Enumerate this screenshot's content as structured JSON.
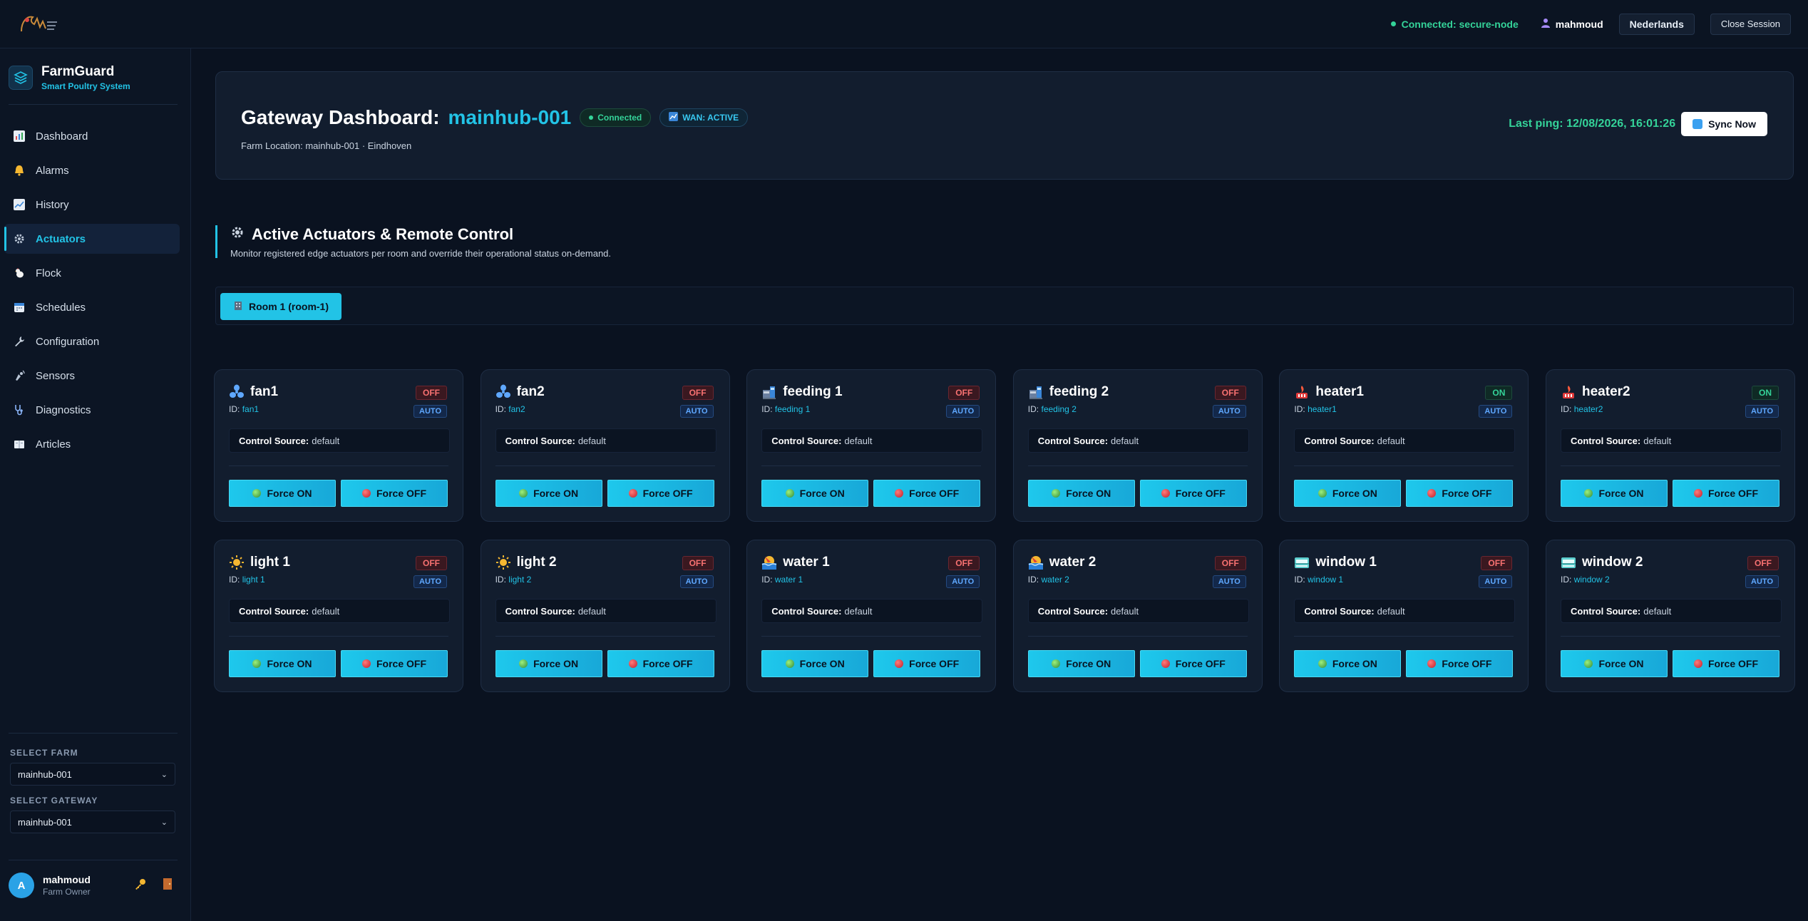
{
  "topbar": {
    "connection": "Connected: secure-node",
    "user": "mahmoud",
    "language": "Nederlands",
    "close_session": "Close Session"
  },
  "sidebar": {
    "brand_name": "FarmGuard",
    "brand_sub": "Smart Poultry System",
    "items": [
      {
        "label": "Dashboard",
        "icon": "chart-icon"
      },
      {
        "label": "Alarms",
        "icon": "bell-icon"
      },
      {
        "label": "History",
        "icon": "trend-icon"
      },
      {
        "label": "Actuators",
        "icon": "gear-icon",
        "active": true
      },
      {
        "label": "Flock",
        "icon": "chicken-icon"
      },
      {
        "label": "Schedules",
        "icon": "calendar-icon"
      },
      {
        "label": "Configuration",
        "icon": "wrench-icon"
      },
      {
        "label": "Sensors",
        "icon": "sensor-icon"
      },
      {
        "label": "Diagnostics",
        "icon": "stethoscope-icon"
      },
      {
        "label": "Articles",
        "icon": "book-icon"
      }
    ],
    "select_farm_label": "SELECT FARM",
    "select_farm_value": "mainhub-001",
    "select_gateway_label": "SELECT GATEWAY",
    "select_gateway_value": "mainhub-001",
    "user_initial": "A",
    "user_name": "mahmoud",
    "user_role": "Farm Owner"
  },
  "gateway": {
    "title": "Gateway Dashboard:",
    "hub": "mainhub-001",
    "connected": "Connected",
    "wan": "WAN: ACTIVE",
    "location": "Farm Location: mainhub-001 · Eindhoven",
    "last_ping": "Last ping: 12/08/2026, 16:01:26",
    "sync": "Sync Now"
  },
  "section": {
    "title": "Active Actuators & Remote Control",
    "desc": "Monitor registered edge actuators per room and override their operational status on-demand."
  },
  "room_tab": "Room 1 (room-1)",
  "labels": {
    "id_prefix": "ID:",
    "control_source": "Control Source:",
    "force_on": "Force ON",
    "force_off": "Force OFF"
  },
  "actuators": [
    {
      "name": "fan1",
      "id": "fan1",
      "state": "OFF",
      "mode": "AUTO",
      "source": "default",
      "icon": "fan-icon"
    },
    {
      "name": "fan2",
      "id": "fan2",
      "state": "OFF",
      "mode": "AUTO",
      "source": "default",
      "icon": "fan-icon"
    },
    {
      "name": "feeding 1",
      "id": "feeding 1",
      "state": "OFF",
      "mode": "AUTO",
      "source": "default",
      "icon": "feeder-icon"
    },
    {
      "name": "feeding 2",
      "id": "feeding 2",
      "state": "OFF",
      "mode": "AUTO",
      "source": "default",
      "icon": "feeder-icon"
    },
    {
      "name": "heater1",
      "id": "heater1",
      "state": "ON",
      "mode": "AUTO",
      "source": "default",
      "icon": "heater-icon"
    },
    {
      "name": "heater2",
      "id": "heater2",
      "state": "ON",
      "mode": "AUTO",
      "source": "default",
      "icon": "heater-icon"
    },
    {
      "name": "light 1",
      "id": "light 1",
      "state": "OFF",
      "mode": "AUTO",
      "source": "default",
      "icon": "sun-icon"
    },
    {
      "name": "light 2",
      "id": "light 2",
      "state": "OFF",
      "mode": "AUTO",
      "source": "default",
      "icon": "sun-icon"
    },
    {
      "name": "water 1",
      "id": "water 1",
      "state": "OFF",
      "mode": "AUTO",
      "source": "default",
      "icon": "water-icon"
    },
    {
      "name": "water 2",
      "id": "water 2",
      "state": "OFF",
      "mode": "AUTO",
      "source": "default",
      "icon": "water-icon"
    },
    {
      "name": "window 1",
      "id": "window 1",
      "state": "OFF",
      "mode": "AUTO",
      "source": "default",
      "icon": "window-icon"
    },
    {
      "name": "window 2",
      "id": "window 2",
      "state": "OFF",
      "mode": "AUTO",
      "source": "default",
      "icon": "window-icon"
    }
  ],
  "colors": {
    "accent": "#22c3e6",
    "on": "#34d399",
    "off": "#f87171",
    "background": "#0a1220"
  }
}
